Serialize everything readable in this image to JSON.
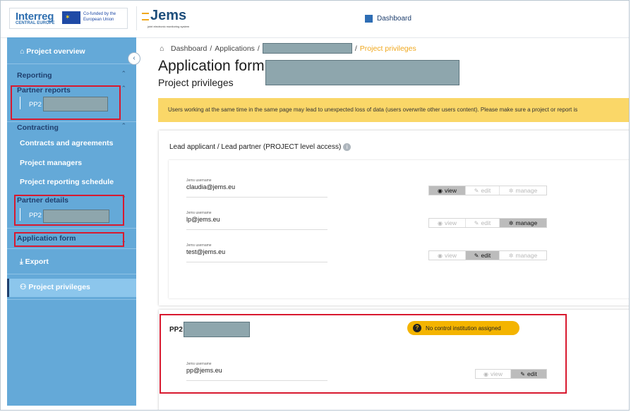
{
  "header": {
    "org_name": "Interreg",
    "org_region": "CENTRAL EUROPE",
    "cofunded_text": "Co-funded by the European Union",
    "app_logo": "Jems",
    "app_logo_sub": "joint electronic monitoring system",
    "dashboard_label": "Dashboard"
  },
  "sidebar": {
    "collapse_icon": "chevron-left-icon",
    "project_overview": "Project overview",
    "reporting": "Reporting",
    "partner_reports": "Partner reports",
    "partner_reports_pp": "PP2",
    "contracting": "Contracting",
    "contracts": "Contracts and agreements",
    "project_managers": "Project managers",
    "reporting_schedule": "Project reporting schedule",
    "partner_details": "Partner details",
    "partner_details_pp": "PP2",
    "application_form": "Application form",
    "export": "Export",
    "project_privileges": "Project privileges"
  },
  "breadcrumb": {
    "dashboard": "Dashboard",
    "sep": "/",
    "applications": "Applications",
    "current": "Project privileges"
  },
  "page": {
    "title": "Application form",
    "subtitle": "Project privileges",
    "warning": "Users working at the same time in the same page may lead to unexpected loss of data (users overwrite other users content). Please make sure a project or report is"
  },
  "lead_section": {
    "title": "Lead applicant / Lead partner (PROJECT level access)",
    "users": [
      {
        "label": "Jems username",
        "value": "claudia@jems.eu",
        "active": "view"
      },
      {
        "label": "Jems username",
        "value": "lp@jems.eu",
        "active": "manage"
      },
      {
        "label": "Jems username",
        "value": "test@jems.eu",
        "active": "edit"
      }
    ],
    "toggle_labels": {
      "view": "view",
      "edit": "edit",
      "manage": "manage"
    }
  },
  "pp_section": {
    "title": "PP2",
    "badge": "No control institution assigned",
    "user": {
      "label": "Jems username",
      "value": "pp@jems.eu",
      "active": "edit"
    },
    "toggle_labels": {
      "view": "view",
      "edit": "edit"
    }
  },
  "colors": {
    "sidebar": "#64a9d8",
    "accent": "#f0a81e",
    "warning_bg": "#fad768",
    "highlight_red": "#d8192f"
  }
}
